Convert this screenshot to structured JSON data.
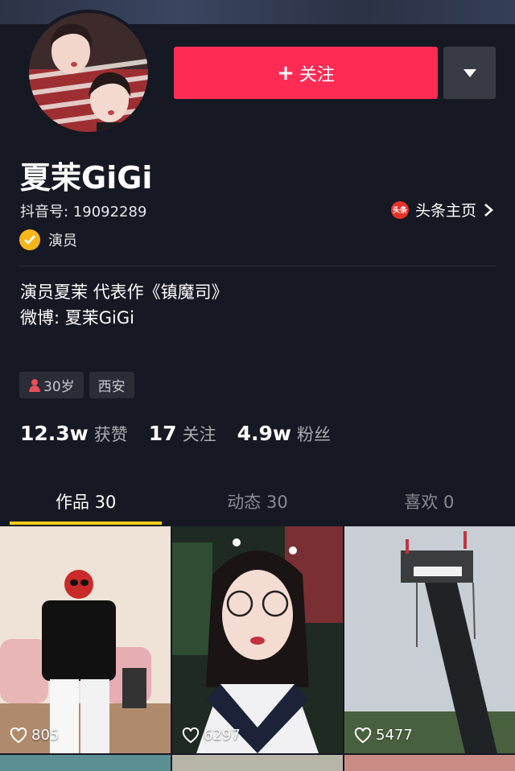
{
  "profile": {
    "nickname": "夏茉GiGi",
    "douyin_id": "抖音号: 19092289",
    "verification": "演员",
    "bio_line1": "演员夏茉  代表作《镇魔司》",
    "bio_line2": "微博: 夏茉GiGi"
  },
  "actions": {
    "follow_label": "关注",
    "follow_plus": "+"
  },
  "toutiao": {
    "logo_text": "头条",
    "label": "头条主页"
  },
  "tags": {
    "age": "30岁",
    "city": "西安"
  },
  "stats": {
    "likes_num": "12.3w",
    "likes_label": "获赞",
    "following_num": "17",
    "following_label": "关注",
    "followers_num": "4.9w",
    "followers_label": "粉丝"
  },
  "tabs": {
    "works": "作品 30",
    "dynamics": "动态 30",
    "likes": "喜欢 0"
  },
  "videos": [
    {
      "likes": "805"
    },
    {
      "likes": "6297"
    },
    {
      "likes": "5477"
    }
  ],
  "colors": {
    "accent": "#fe2c55",
    "tab_underline": "#fbcd1c",
    "background": "#161823",
    "verify_badge": "#f7b61a"
  },
  "icons": [
    "plus-icon",
    "dropdown-arrow-icon",
    "toutiao-logo-icon",
    "chevron-right-icon",
    "verified-badge-icon",
    "female-icon",
    "heart-icon"
  ]
}
